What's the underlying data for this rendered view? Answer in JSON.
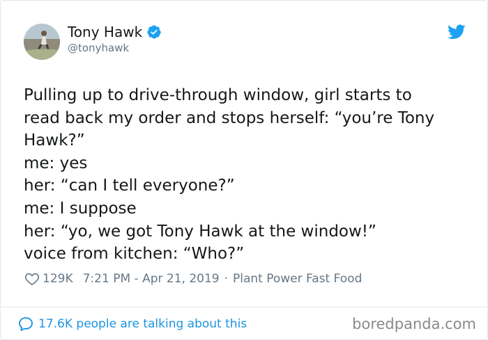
{
  "tweet": {
    "author": {
      "display_name": "Tony Hawk",
      "handle": "@tonyhawk",
      "verified": true,
      "avatar_icon": "avatar"
    },
    "text": "Pulling up to drive-through window, girl starts to\nread back my order and stops herself: “you’re Tony\nHawk?”\nme: yes\nher: “can I tell everyone?”\nme: I suppose\nher: “yo, we got Tony Hawk at the window!”\nvoice from kitchen: “Who?”",
    "likes": "129K",
    "time": "7:21 PM",
    "date": "Apr 21, 2019",
    "time_date_separator": " - ",
    "source_separator": "·",
    "source": "Plant Power Fast Food",
    "talking": "17.6K people are talking about this"
  },
  "watermark": "boredpanda.com",
  "colors": {
    "twitter_blue": "#1da1f2",
    "link_blue": "#1b95e0",
    "secondary_text": "#657786",
    "primary_text": "#14171a",
    "border": "#e1e8ed"
  },
  "icons": {
    "verified": "verified-badge-icon",
    "bird": "twitter-bird-icon",
    "heart": "heart-outline-icon",
    "reply": "speech-bubble-icon"
  }
}
